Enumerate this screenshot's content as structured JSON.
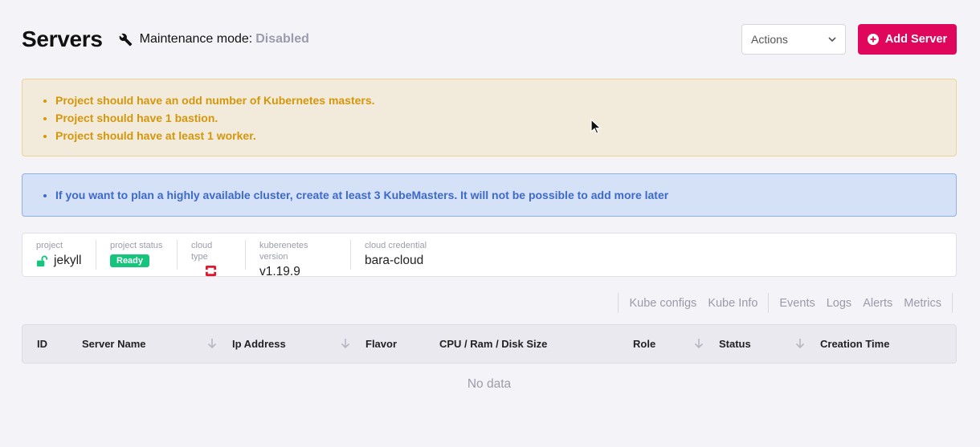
{
  "header": {
    "title": "Servers",
    "maintenance_label": "Maintenance mode:",
    "maintenance_value": "Disabled",
    "actions_label": "Actions",
    "add_server_label": "Add Server"
  },
  "warnings": [
    "Project should have an odd number of Kubernetes masters.",
    "Project should have 1 bastion.",
    "Project should have at least 1 worker."
  ],
  "info_messages": [
    "If you want to plan a highly available cluster, create at least 3 KubeMasters. It will not be possible to add more later"
  ],
  "project_info": {
    "project_label": "project",
    "project_value": "jekyll",
    "status_label": "project status",
    "status_value": "Ready",
    "cloud_type_label": "cloud type",
    "cloud_type_icon": "openstack-icon",
    "k8s_label": "kuberenetes version",
    "k8s_value": "v1.19.9",
    "credential_label": "cloud credential",
    "credential_value": "bara-cloud"
  },
  "tabs": [
    "Kube configs",
    "Kube Info",
    "Events",
    "Logs",
    "Alerts",
    "Metrics"
  ],
  "table": {
    "columns": [
      "ID",
      "Server Name",
      "Ip Address",
      "Flavor",
      "CPU / Ram / Disk Size",
      "Role",
      "Status",
      "Creation Time"
    ],
    "empty_text": "No data"
  },
  "colors": {
    "accent": "#e0065b",
    "ready": "#16c47e",
    "warning_text": "#d4970b",
    "info_text": "#3d6ac8"
  }
}
